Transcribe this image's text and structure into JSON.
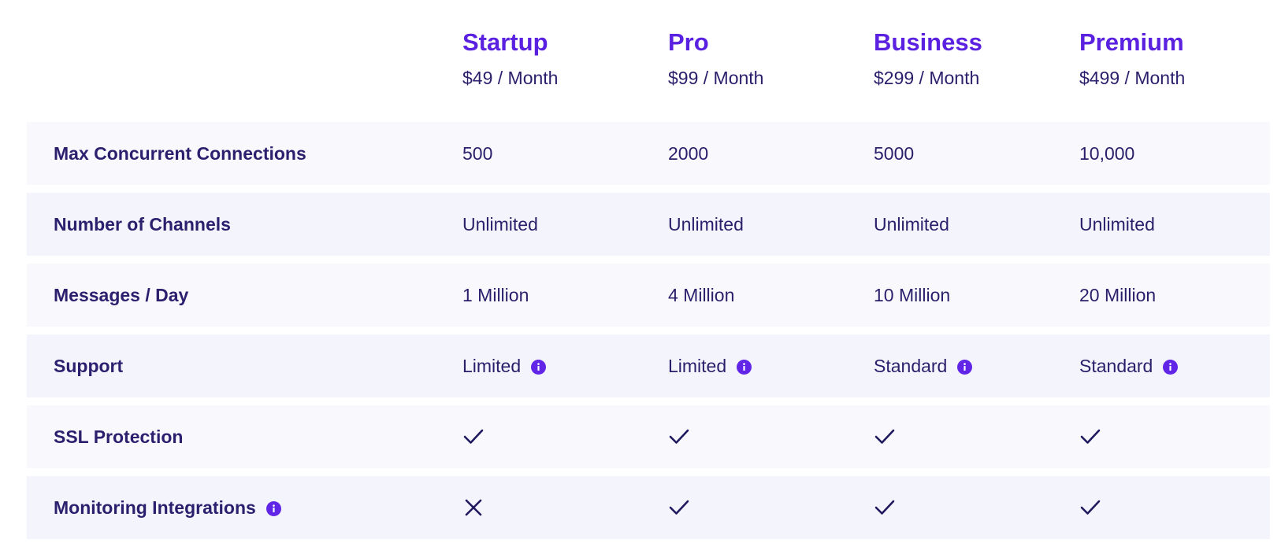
{
  "plans": [
    {
      "name": "Startup",
      "price": "$49 / Month"
    },
    {
      "name": "Pro",
      "price": "$99 / Month"
    },
    {
      "name": "Business",
      "price": "$299 / Month"
    },
    {
      "name": "Premium",
      "price": "$499 / Month"
    }
  ],
  "rows": [
    {
      "feature": "Max Concurrent Connections",
      "values": [
        "500",
        "2000",
        "5000",
        "10,000"
      ]
    },
    {
      "feature": "Number of Channels",
      "values": [
        "Unlimited",
        "Unlimited",
        "Unlimited",
        "Unlimited"
      ]
    },
    {
      "feature": "Messages / Day",
      "values": [
        "1 Million",
        "4 Million",
        "10 Million",
        "20 Million"
      ]
    },
    {
      "feature": "Support",
      "values": [
        "Limited",
        "Limited",
        "Standard",
        "Standard"
      ]
    },
    {
      "feature": "SSL Protection",
      "values": [
        "check-icon",
        "check-icon",
        "check-icon",
        "check-icon"
      ]
    },
    {
      "feature": "Monitoring Integrations",
      "values": [
        "cross-icon",
        "check-icon",
        "check-icon",
        "check-icon"
      ]
    }
  ],
  "colors": {
    "accent": "#5b21e0",
    "text": "#2a1f6b",
    "row_bg_light": "#f8f8fd",
    "row_bg_dark": "#f4f4fc"
  }
}
